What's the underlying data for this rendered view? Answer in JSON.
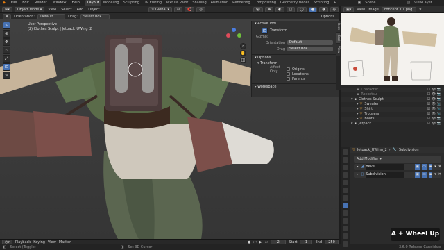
{
  "topbar": {
    "menus": [
      "File",
      "Edit",
      "Render",
      "Window",
      "Help"
    ],
    "workspaces": [
      "Layout",
      "Modeling",
      "Sculpting",
      "UV Editing",
      "Texture Paint",
      "Shading",
      "Animation",
      "Rendering",
      "Compositing",
      "Geometry Nodes",
      "Scripting"
    ],
    "active_workspace": "Layout",
    "scene_label": "Scene",
    "viewlayer_label": "ViewLayer"
  },
  "viewport_header": {
    "mode": "Object Mode",
    "menus": [
      "View",
      "Select",
      "Add",
      "Object"
    ],
    "transform_orientation": "Global",
    "orientation_label": "Orientation:",
    "orientation_value": "Default",
    "drag_label": "Drag:",
    "drag_value": "Select Box",
    "options_label": "Options"
  },
  "viewport": {
    "perspective_label": "User Perspective",
    "object_label": "(2) Clothes Sculpt | Jetpack_UWing_2"
  },
  "npanel": {
    "active_tool_title": "Active Tool",
    "tool_name": "Transform",
    "gizmo_label": "Gizmo:",
    "orientation_label": "Orientation",
    "orientation_value": "Default",
    "drag_label": "Drag",
    "drag_value": "Select Box",
    "options_title": "Options",
    "transform_title": "Transform",
    "affect_only_label": "Affect Only",
    "affect_items": [
      "Origins",
      "Locations",
      "Parents"
    ],
    "workspace_title": "Workspace",
    "tabs": [
      "Item",
      "Tool",
      "View"
    ]
  },
  "bottom": {
    "menus": [
      "Playback",
      "Keying",
      "View",
      "Marker"
    ],
    "current_frame": "2",
    "start_label": "Start",
    "start_value": "1",
    "end_label": "End",
    "end_value": "250"
  },
  "statusbar": {
    "left": "Select (Toggle)",
    "middle": "Set 3D Cursor",
    "version": "3.6.0 Release Candidate"
  },
  "image_editor": {
    "menus": [
      "View",
      "Image"
    ],
    "image_name": "concept 3.1.png"
  },
  "outliner": {
    "rows": [
      {
        "name": "Character",
        "indent": 2,
        "dim": true
      },
      {
        "name": "Rocketsui",
        "indent": 2,
        "dim": true
      },
      {
        "name": "Clothes Sculpt",
        "indent": 1,
        "dim": false
      },
      {
        "name": "Sweater",
        "indent": 2,
        "dim": false
      },
      {
        "name": "Shirt",
        "indent": 2,
        "dim": false
      },
      {
        "name": "Trousers",
        "indent": 2,
        "dim": false
      },
      {
        "name": "Boots",
        "indent": 2,
        "dim": false
      },
      {
        "name": "Jetpack",
        "indent": 1,
        "dim": false
      }
    ]
  },
  "properties": {
    "object_name": "Jetpack_UWing_2",
    "modifier_name": "Subdivision",
    "add_modifier_label": "Add Modifier",
    "modifiers": [
      "Bevel",
      "Subdivision"
    ]
  },
  "overlay": {
    "key_hint": "A + Wheel Up"
  }
}
